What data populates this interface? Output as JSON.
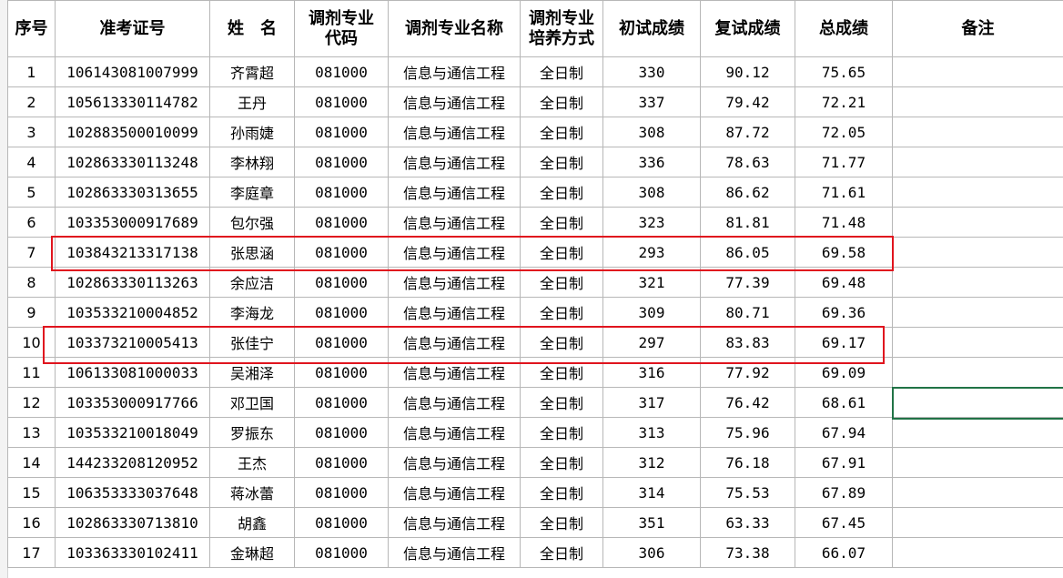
{
  "headers": [
    "序号",
    "准考证号",
    "姓　名",
    "调剂专业\n代码",
    "调剂专业名称",
    "调剂专业\n培养方式",
    "初试成绩",
    "复试成绩",
    "总成绩",
    "备注"
  ],
  "rows": [
    [
      "1",
      "106143081007999",
      "齐霄超",
      "081000",
      "信息与通信工程",
      "全日制",
      "330",
      "90.12",
      "75.65",
      ""
    ],
    [
      "2",
      "105613330114782",
      "王丹",
      "081000",
      "信息与通信工程",
      "全日制",
      "337",
      "79.42",
      "72.21",
      ""
    ],
    [
      "3",
      "102883500010099",
      "孙雨婕",
      "081000",
      "信息与通信工程",
      "全日制",
      "308",
      "87.72",
      "72.05",
      ""
    ],
    [
      "4",
      "102863330113248",
      "李林翔",
      "081000",
      "信息与通信工程",
      "全日制",
      "336",
      "78.63",
      "71.77",
      ""
    ],
    [
      "5",
      "102863330313655",
      "李庭章",
      "081000",
      "信息与通信工程",
      "全日制",
      "308",
      "86.62",
      "71.61",
      ""
    ],
    [
      "6",
      "103353000917689",
      "包尔强",
      "081000",
      "信息与通信工程",
      "全日制",
      "323",
      "81.81",
      "71.48",
      ""
    ],
    [
      "7",
      "103843213317138",
      "张思涵",
      "081000",
      "信息与通信工程",
      "全日制",
      "293",
      "86.05",
      "69.58",
      ""
    ],
    [
      "8",
      "102863330113263",
      "余应洁",
      "081000",
      "信息与通信工程",
      "全日制",
      "321",
      "77.39",
      "69.48",
      ""
    ],
    [
      "9",
      "103533210004852",
      "李海龙",
      "081000",
      "信息与通信工程",
      "全日制",
      "309",
      "80.71",
      "69.36",
      ""
    ],
    [
      "10",
      "103373210005413",
      "张佳宁",
      "081000",
      "信息与通信工程",
      "全日制",
      "297",
      "83.83",
      "69.17",
      ""
    ],
    [
      "11",
      "106133081000033",
      "吴湘泽",
      "081000",
      "信息与通信工程",
      "全日制",
      "316",
      "77.92",
      "69.09",
      ""
    ],
    [
      "12",
      "103353000917766",
      "邓卫国",
      "081000",
      "信息与通信工程",
      "全日制",
      "317",
      "76.42",
      "68.61",
      ""
    ],
    [
      "13",
      "103533210018049",
      "罗振东",
      "081000",
      "信息与通信工程",
      "全日制",
      "313",
      "75.96",
      "67.94",
      ""
    ],
    [
      "14",
      "144233208120952",
      "王杰",
      "081000",
      "信息与通信工程",
      "全日制",
      "312",
      "76.18",
      "67.91",
      ""
    ],
    [
      "15",
      "106353333037648",
      "蒋冰蕾",
      "081000",
      "信息与通信工程",
      "全日制",
      "314",
      "75.53",
      "67.89",
      ""
    ],
    [
      "16",
      "102863330713810",
      "胡鑫",
      "081000",
      "信息与通信工程",
      "全日制",
      "351",
      "63.33",
      "67.45",
      ""
    ],
    [
      "17",
      "103363330102411",
      "金琳超",
      "081000",
      "信息与通信工程",
      "全日制",
      "306",
      "73.38",
      "66.07",
      ""
    ]
  ],
  "highlighted_rows": [
    "7",
    "10"
  ],
  "colors": {
    "highlight_border": "#e0141e",
    "active_cell_border": "#217346",
    "gridline": "#b7b7b7"
  }
}
